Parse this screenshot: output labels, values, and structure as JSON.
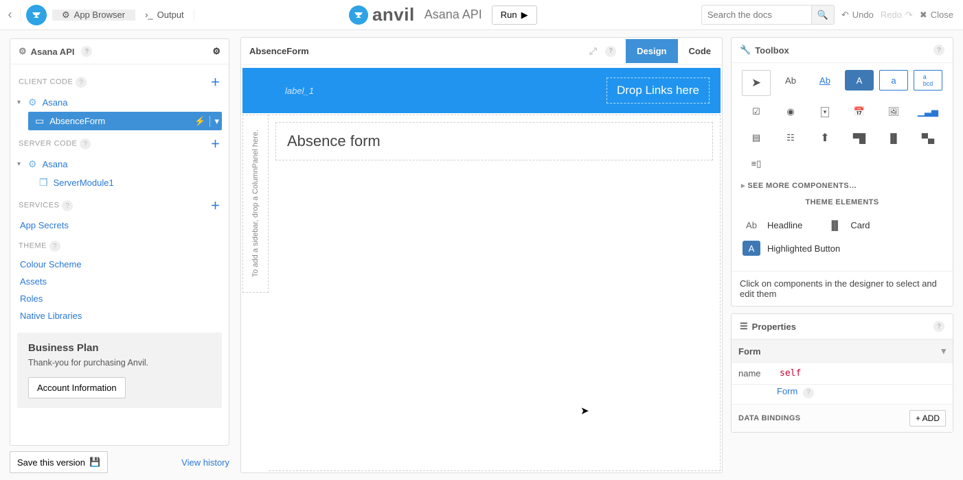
{
  "topbar": {
    "tab_app_browser": "App Browser",
    "tab_output": "Output",
    "app_name": "Asana API",
    "run_label": "Run",
    "search_placeholder": "Search the docs",
    "undo_label": "Undo",
    "redo_label": "Redo",
    "close_label": "Close",
    "brand_word": "anvil"
  },
  "sidebar": {
    "title": "Asana API",
    "sections": {
      "client_code": "CLIENT CODE",
      "server_code": "SERVER CODE",
      "services": "SERVICES",
      "theme": "THEME"
    },
    "client_items": {
      "asana": "Asana",
      "absence_form": "AbsenceForm"
    },
    "server_items": {
      "asana": "Asana",
      "server_module": "ServerModule1"
    },
    "services_items": {
      "app_secrets": "App Secrets"
    },
    "theme_items": {
      "colour_scheme": "Colour Scheme",
      "assets": "Assets",
      "roles": "Roles",
      "native_libraries": "Native Libraries"
    },
    "plan": {
      "title": "Business Plan",
      "thanks": "Thank-you for purchasing Anvil.",
      "account_btn": "Account Information"
    },
    "save_btn": "Save this version",
    "view_history": "View history"
  },
  "center": {
    "form_title": "AbsenceForm",
    "tab_design": "Design",
    "tab_code": "Code",
    "banner_label": "label_1",
    "banner_drop": "Drop Links here",
    "sidebar_drop_text": "To add a sidebar, drop a ColumnPanel here.",
    "card_heading": "Absence form"
  },
  "toolbox": {
    "title": "Toolbox",
    "see_more": "SEE MORE COMPONENTS…",
    "theme_elements": "THEME ELEMENTS",
    "theme_items": {
      "headline": "Headline",
      "card": "Card",
      "highlighted_button": "Highlighted Button"
    },
    "hint": "Click on components in the designer to select and edit them",
    "tool_label_text": "Ab",
    "tool_link_text": "Ab",
    "tool_button_text": "A",
    "tool_textbox_text": "a"
  },
  "properties": {
    "title": "Properties",
    "section": "Form",
    "name_key": "name",
    "name_val": "self",
    "form_link": "Form",
    "bindings_label": "DATA BINDINGS",
    "add_label": "+ ADD"
  }
}
